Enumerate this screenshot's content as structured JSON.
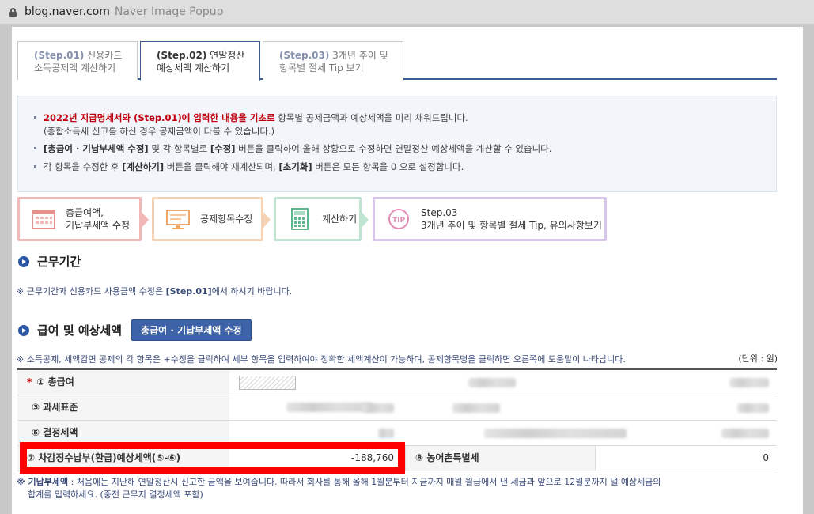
{
  "browser": {
    "domain": "blog.naver.com",
    "page_title": "Naver Image Popup"
  },
  "tabs": [
    {
      "step": "(Step.01)",
      "line1": "신용카드",
      "line2": "소득공제액 계산하기"
    },
    {
      "step": "(Step.02)",
      "line1": "연말정산",
      "line2": "예상세액 계산하기"
    },
    {
      "step": "(Step.03)",
      "line1": "3개년 추이 및",
      "line2": "항목별 절세 Tip 보기"
    }
  ],
  "info": {
    "l1_red": "2022년 지급명세서와 (Step.01)에 입력한 내용을 기초로",
    "l1_rest": " 항목별 공제금액과 예상세액을 미리 채워드립니다.",
    "l1_sub": "(종합소득세 신고를 하신 경우 공제금액이 다를 수 있습니다.)",
    "l2_b1": "[총급여 · 기납부세액 수정]",
    "l2_t1": " 및 각 항목별로 ",
    "l2_b2": "[수정]",
    "l2_t2": " 버튼을 클릭하여 올해 상황으로 수정하면 연말정산 예상세액을 계산할 수 있습니다.",
    "l3_t1": "각 항목을 수정한 후 ",
    "l3_b1": "[계산하기]",
    "l3_t2": " 버튼을 클릭해야 재계산되며, ",
    "l3_b2": "[초기화]",
    "l3_t3": " 버튼은 모든 항목을 0 으로 설정합니다."
  },
  "process": [
    {
      "line1": "총급여액,",
      "line2": "기납부세액 수정",
      "icon": "calendar-icon",
      "color": "#f2b8b8"
    },
    {
      "line1": "공제항목수정",
      "line2": "",
      "icon": "monitor-icon",
      "color": "#f6d3b4"
    },
    {
      "line1": "계산하기",
      "line2": "",
      "icon": "calculator-icon",
      "color": "#bfe4d2"
    },
    {
      "line1": "Step.03",
      "line2": "3개년 추이 및 항목별 절세 Tip, 유의사항보기",
      "icon": "tip-icon",
      "color": "#d9c6ec"
    }
  ],
  "work_period": {
    "title": "근무기간",
    "note_t1": "※ 근무기간과 신용카드 사용금액 수정은 ",
    "note_b": "[Step.01]",
    "note_t2": "에서 하시기 바랍니다."
  },
  "salary": {
    "title": "급여 및 예상세액",
    "edit_button": "총급여 · 기납부세액 수정",
    "note": "※ 소득공제, 세액감면 공제의 각 항목은 +수정을 클릭하여 세부 항목을 입력하여야 정확한 세액계산이 가능하며, 공제항목명을 클릭하면 오른쪽에 도움말이 나타납니다.",
    "unit": "(단위 : 원)",
    "rows": [
      {
        "req": "*",
        "label": "① 총급여"
      },
      {
        "req": "",
        "label": "③ 과세표준"
      },
      {
        "req": "",
        "label": "⑤ 결정세액"
      },
      {
        "req": "",
        "label": "⑦ 차감징수납부(환급)예상세액(⑤-⑥)",
        "value": "-188,760",
        "label2": "⑧ 농어촌특별세",
        "value2": "0"
      }
    ]
  },
  "footnote": {
    "b": "※ 기납부세액",
    "t1": " : 처음에는 지난해 연말정산시 신고한 금액을 보여줍니다. 따라서 회사를 통해 올해 1월분부터 지금까지 매월 월급에서 낸 세금과 앞으로 12월분까지 낼 예상세금의",
    "t2": "합계를 입력하세요. (중전 근무지 결정세액 포함)"
  },
  "colors": {
    "accent": "#3d5b95",
    "highlight": "#ff0000",
    "required": "#cc0000"
  }
}
